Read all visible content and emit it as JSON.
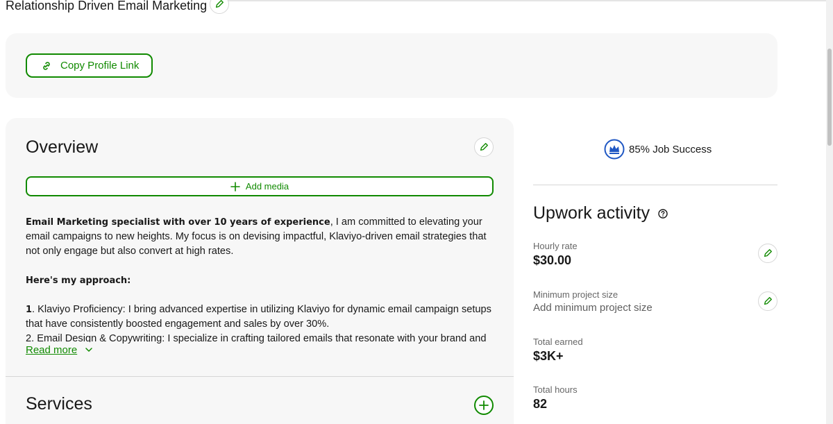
{
  "profile": {
    "title": "Relationship Driven Email Marketing"
  },
  "copy_link": {
    "label": "Copy Profile Link"
  },
  "overview": {
    "title": "Overview",
    "add_media_label": "Add media",
    "intro_bold": "Email Marketing specialist with over 10 years of experience",
    "intro_rest": ", I am committed to elevating your email campaigns to new heights. My focus is on devising impactful, Klaviyo-driven email strategies that not only engage but also convert at high rates.",
    "approach_heading": "Here's my approach:",
    "point1_num": "1",
    "point1_text": ". Klaviyo Proficiency: I bring advanced expertise in utilizing Klaviyo for dynamic email campaign setups that have consistently boosted engagement and sales by over 30%.",
    "point2_partial": "2. Email Design & Copywriting: I specialize in crafting tailored emails that resonate with your brand and",
    "read_more_label": "Read more"
  },
  "services": {
    "title": "Services"
  },
  "job_success": {
    "text": "85% Job Success"
  },
  "activity": {
    "title": "Upwork activity",
    "hourly_rate_label": "Hourly rate",
    "hourly_rate_value": "$30.00",
    "min_project_label": "Minimum project size",
    "min_project_value": "Add minimum project size",
    "total_earned_label": "Total earned",
    "total_earned_value": "$3K+",
    "total_hours_label": "Total hours",
    "total_hours_value": "82"
  },
  "colors": {
    "brand_green": "#108a00",
    "badge_blue": "#1f57c3",
    "panel_bg": "#f7f7f7"
  }
}
